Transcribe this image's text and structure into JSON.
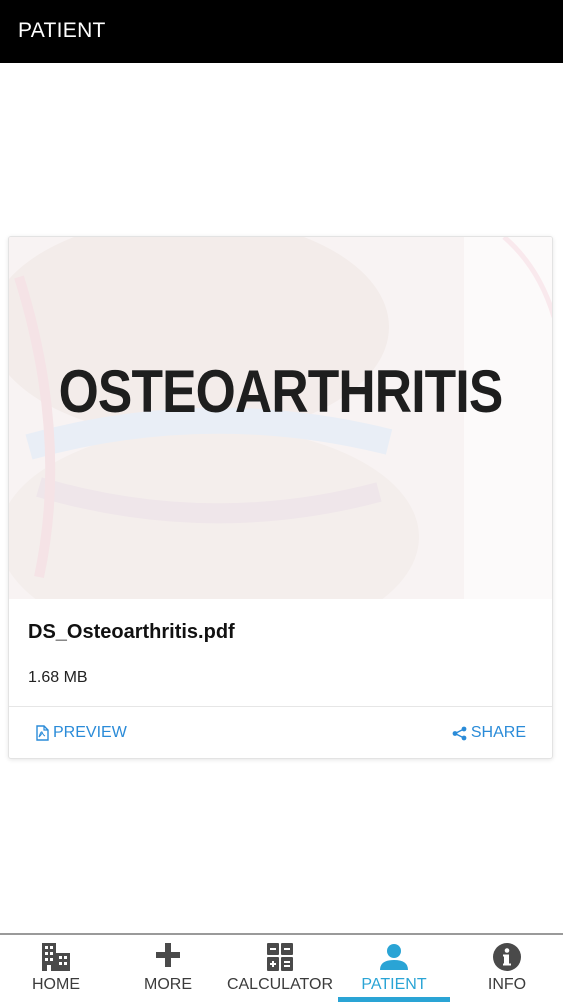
{
  "header": {
    "title": "PATIENT"
  },
  "document": {
    "thumbnail_text": "OSTEOARTHRITIS",
    "filename": "DS_Osteoarthritis.pdf",
    "size": "1.68 MB",
    "preview_label": "PREVIEW",
    "share_label": "SHARE"
  },
  "nav": {
    "items": [
      {
        "label": "HOME",
        "icon": "building-icon"
      },
      {
        "label": "MORE",
        "icon": "plus-icon"
      },
      {
        "label": "CALCULATOR",
        "icon": "calculator-icon"
      },
      {
        "label": "PATIENT",
        "icon": "user-icon",
        "active": true
      },
      {
        "label": "INFO",
        "icon": "info-icon"
      }
    ]
  },
  "colors": {
    "accent": "#2aa4d5",
    "link": "#2a8bd8",
    "header_bg": "#000000"
  }
}
